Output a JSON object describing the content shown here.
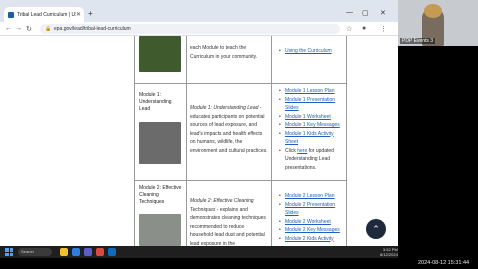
{
  "browser": {
    "tab_title": "Tribal Lead Curriculum | US EPA",
    "url": "epa.gov/lead/tribal-lead-curriculum",
    "icons": [
      "back-icon",
      "forward-icon",
      "reload-icon",
      "lock-icon",
      "star-icon",
      "menu-icon"
    ]
  },
  "webcam": {
    "label": "PDP Events 3"
  },
  "page": {
    "top_row": {
      "description": "each Module to teach the Curriculum in your community.",
      "resources": [
        {
          "text": "Using the Curriculum",
          "link": true
        }
      ]
    },
    "modules": [
      {
        "name": "Module 1: Understanding Lead",
        "description_italic": "Module 1: Understanding Lead",
        "description_rest": " - educates participants on potential sources of lead exposure, and lead's impacts and health effects on humans, wildlife, the environment and cultural practices.",
        "resources": [
          {
            "text": "Module 1 Lesson Plan",
            "link": true
          },
          {
            "text": "Module 1 Presentation Slides",
            "link": true
          },
          {
            "text": "Module 1 Worksheet",
            "link": true
          },
          {
            "text": "Module 1 Key Messages",
            "link": true
          },
          {
            "text": "Module 1 Kids Activity Sheet",
            "link": true
          }
        ],
        "note_prefix": "Click ",
        "note_link": "here",
        "note_suffix": " for updated Understanding Lead presentations."
      },
      {
        "name": "Module 2: Effective Cleaning Techniques",
        "description_italic": "Module 2: Effective Cleaning Techniques",
        "description_rest": " - explains and demonstrates cleaning techniques recommended to reduce household lead dust and potential lead exposure in the",
        "resources": [
          {
            "text": "Module 2 Lesson Plan",
            "link": true
          },
          {
            "text": "Module 2 Presentation Slides",
            "link": true
          },
          {
            "text": "Module 2 Worksheet",
            "link": true
          },
          {
            "text": "Module 2 Key Messages",
            "link": true
          },
          {
            "text": "Module 2 Kids Activity",
            "link": true
          }
        ]
      }
    ],
    "scroll_top_icon": "chevron-up-icon"
  },
  "taskbar": {
    "search_placeholder": "Search",
    "time": "3:52 PM",
    "date": "8/12/2024"
  },
  "recording_timestamp": "2024-08-12 15:31:44"
}
